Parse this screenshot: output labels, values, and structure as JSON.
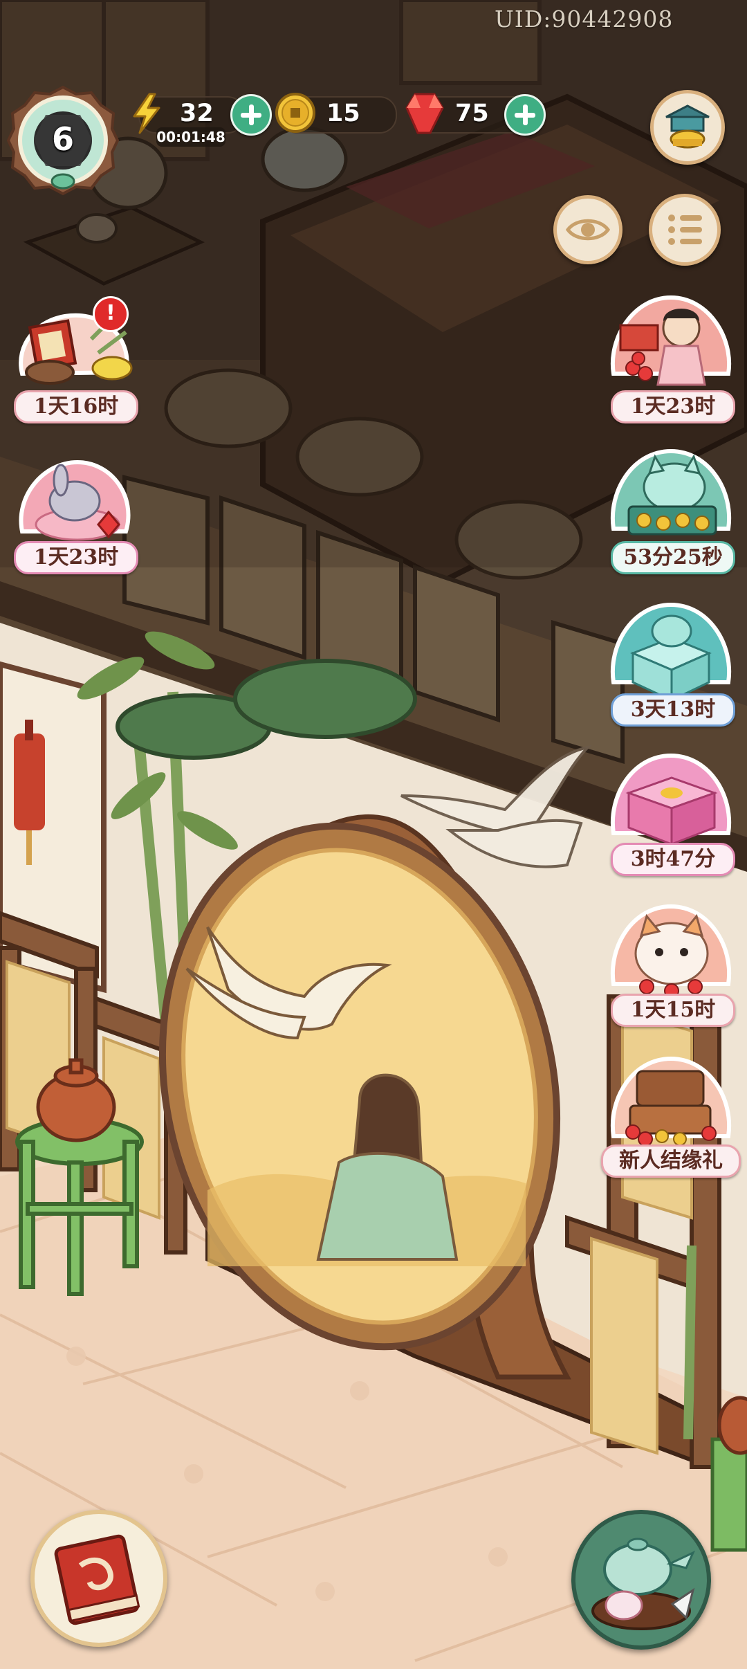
{
  "hud": {
    "uid": "UID:90442908",
    "level": "6",
    "energy": {
      "value": "32",
      "timer": "00:01:48",
      "icon": "lightning-icon"
    },
    "coins": {
      "value": "15",
      "icon": "copper-coin-icon"
    },
    "gems": {
      "value": "75",
      "icon": "red-gem-icon"
    }
  },
  "events_left": [
    {
      "name": "new-year-gift-event",
      "icon": "firecracker-basket-icon",
      "timer": "1天16时",
      "alert": "!"
    },
    {
      "name": "rabbit-event",
      "icon": "rabbit-cushion-icon",
      "timer": "1天23时"
    }
  ],
  "events_right": [
    {
      "name": "girl-event",
      "icon": "girl-with-fruit-icon",
      "timer": "1天23时"
    },
    {
      "name": "lucky-cat-event",
      "icon": "lucky-cat-cart-icon",
      "timer": "53分25秒"
    },
    {
      "name": "jade-cat-event",
      "icon": "jade-cat-box-icon",
      "timer": "3天13时"
    },
    {
      "name": "gift-box-event",
      "icon": "pink-gift-box-icon",
      "timer": "3时47分"
    },
    {
      "name": "fluffy-cat-event",
      "icon": "fluffy-cat-icon",
      "timer": "1天15时"
    },
    {
      "name": "newcomer-gift-event",
      "icon": "treasure-cart-icon",
      "timer": "新人结缘礼"
    }
  ],
  "colors": {
    "accent_green": "#3fae83",
    "wood_brown": "#6b4430",
    "floor": "#f2d9c2"
  }
}
